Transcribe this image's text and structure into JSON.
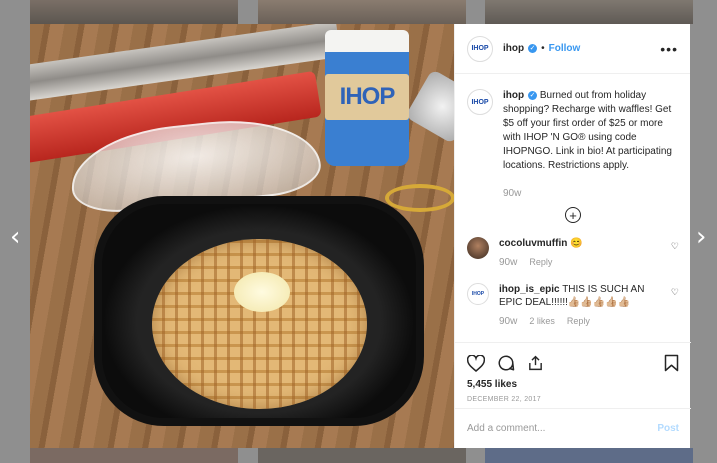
{
  "header": {
    "avatar_text": "IHOP",
    "username": "ihop",
    "separator": "•",
    "follow_label": "Follow",
    "more_label": "•••"
  },
  "photo": {
    "cup_text": "IHOP"
  },
  "caption": {
    "username": "ihop",
    "text": "Burned out from holiday shopping? Recharge with waffles! Get $5 off your first order of $25 or more with IHOP 'N GO® using code IHOPNGO. Link in bio! At participating locations. Restrictions apply.",
    "age": "90w",
    "load_more": "+"
  },
  "comments": [
    {
      "username": "cocoluvmuffin",
      "text": "😊",
      "age": "90w",
      "reply_label": "Reply"
    },
    {
      "username": "ihop_is_epic",
      "text": "THIS IS SUCH AN EPIC DEAL!!!!!!👍🏼👍🏼👍🏼👍🏼👍🏼",
      "age": "90w",
      "likes": "2 likes",
      "reply_label": "Reply"
    }
  ],
  "actions": {
    "likes": "5,455 likes",
    "date": "DECEMBER 22, 2017"
  },
  "add_comment": {
    "placeholder": "Add a comment...",
    "post_label": "Post"
  },
  "nav": {
    "prev": "‹",
    "next": "›"
  },
  "colors": {
    "accent": "#3897f0",
    "post_disabled": "#b3dbff"
  }
}
